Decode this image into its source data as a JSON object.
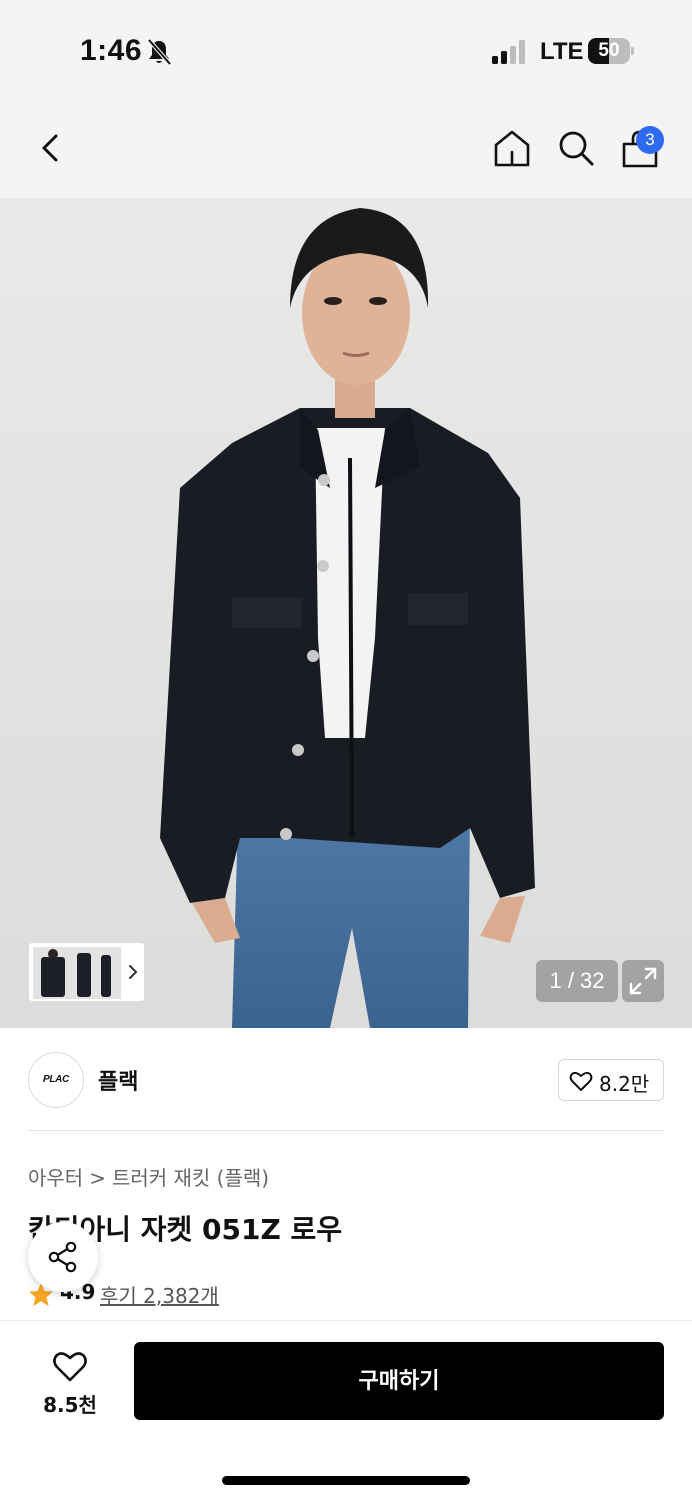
{
  "status_bar": {
    "time": "1:46",
    "network": "LTE",
    "battery_level": "50",
    "battery_fraction": 0.5
  },
  "header": {
    "cart_count": "3"
  },
  "gallery": {
    "counter": "1 / 32"
  },
  "brand": {
    "logo_text": "PLAC",
    "name": "플랙",
    "like_count": "8.2만"
  },
  "product": {
    "breadcrumb": [
      "아우터",
      "트러커 재킷 (플랙)"
    ],
    "breadcrumb_sep": ">",
    "title": "칸디아니 자켓 051Z 로우",
    "rating": "4.9",
    "reviews": "후기 2,382개"
  },
  "bottom_bar": {
    "wish_count": "8.5천",
    "buy_label": "구매하기"
  }
}
